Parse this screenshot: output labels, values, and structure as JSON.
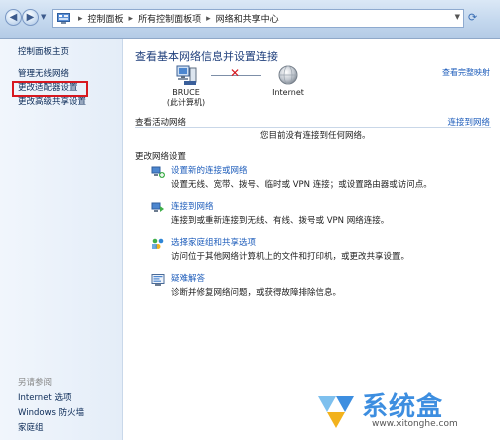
{
  "address_bar": {
    "segments": [
      "控制面板",
      "所有控制面板项",
      "网络和共享中心"
    ]
  },
  "sidebar": {
    "home": "控制面板主页",
    "items": [
      "管理无线网络",
      "更改适配器设置",
      "更改高级共享设置"
    ],
    "see_also_heading": "另请参阅",
    "see_also": [
      "Internet 选项",
      "Windows 防火墙",
      "家庭组"
    ]
  },
  "main": {
    "title": "查看基本网络信息并设置连接",
    "see_full_map": "查看完整映射",
    "map": {
      "computer_name": "BRUCE",
      "computer_sub": "(此计算机)",
      "internet_label": "Internet",
      "status_mark": "✕"
    },
    "active_networks": {
      "heading": "查看活动网络",
      "link": "连接到网络",
      "status": "您目前没有连接到任何网络。"
    },
    "change_settings": {
      "heading": "更改网络设置",
      "tasks": [
        {
          "icon": "network-setup-icon",
          "link": "设置新的连接或网络",
          "desc": "设置无线、宽带、拨号、临时或 VPN 连接；或设置路由器或访问点。"
        },
        {
          "icon": "connect-network-icon",
          "link": "连接到网络",
          "desc": "连接到或重新连接到无线、有线、拨号或 VPN 网络连接。"
        },
        {
          "icon": "homegroup-icon",
          "link": "选择家庭组和共享选项",
          "desc": "访问位于其他网络计算机上的文件和打印机，或更改共享设置。"
        },
        {
          "icon": "troubleshoot-icon",
          "link": "疑难解答",
          "desc": "诊断并修复网络问题，或获得故障排除信息。"
        }
      ]
    }
  },
  "watermark": {
    "brand": "系统盒",
    "url": "www.xitonghe.com"
  },
  "colors": {
    "link": "#1e5dbb",
    "title": "#1e3e7b",
    "highlight": "#d71920"
  }
}
